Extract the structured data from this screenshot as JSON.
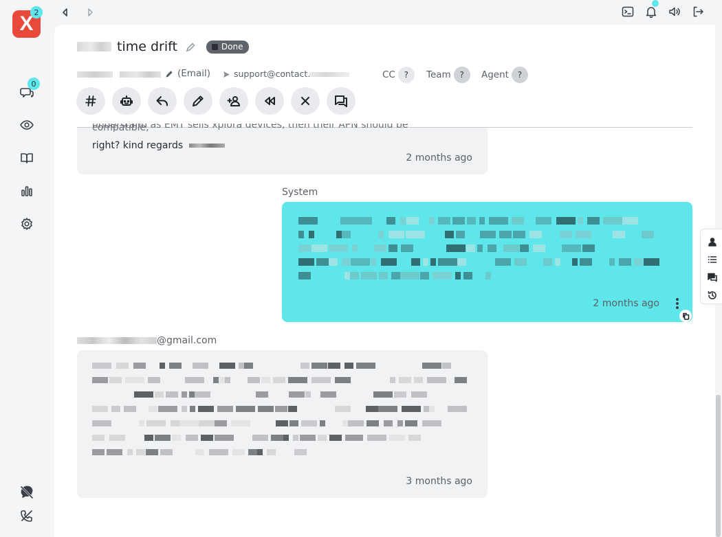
{
  "app": {
    "logo_letter": "X",
    "logo_badge": "2"
  },
  "sidebar": {
    "items": [
      {
        "name": "conversations",
        "icon": "chat-bubbles-icon",
        "badge": "0"
      },
      {
        "name": "watching",
        "icon": "eye-icon"
      },
      {
        "name": "knowledge-base",
        "icon": "book-icon"
      },
      {
        "name": "reports",
        "icon": "bar-chart-icon"
      },
      {
        "name": "settings",
        "icon": "gear-icon"
      }
    ],
    "bottom": [
      {
        "name": "chat-off",
        "icon": "chat-off-icon"
      },
      {
        "name": "phone-off",
        "icon": "phone-off-icon"
      }
    ]
  },
  "ticket": {
    "title": "time drift",
    "status": "Done",
    "customer_suffix": "(Email)",
    "to_address": "support@contact.",
    "cc_label": "CC",
    "team_label": "Team",
    "agent_label": "Agent",
    "unknown": "?"
  },
  "actions": [
    {
      "name": "tags-button",
      "icon": "hash-icon"
    },
    {
      "name": "bot-button",
      "icon": "robot-icon"
    },
    {
      "name": "reply-button",
      "icon": "reply-icon"
    },
    {
      "name": "edit-button",
      "icon": "pencil-icon"
    },
    {
      "name": "assign-button",
      "icon": "add-person-icon"
    },
    {
      "name": "rewind-button",
      "icon": "rewind-icon"
    },
    {
      "name": "close-button",
      "icon": "close-icon"
    },
    {
      "name": "conversation-button",
      "icon": "forum-icon"
    }
  ],
  "messages": [
    {
      "text_cutoff": "understand as EMT sells xplora devices, then their APN should be compatible,",
      "text": "right? kind regards",
      "time": "2 months ago"
    },
    {
      "sender": "System",
      "time": "2 months ago"
    },
    {
      "sender_suffix": "@gmail.com",
      "time": "3 months ago"
    }
  ],
  "colors": {
    "accent": "#5ee6ea",
    "logo": "#e8493b",
    "status": "#5f646b"
  }
}
